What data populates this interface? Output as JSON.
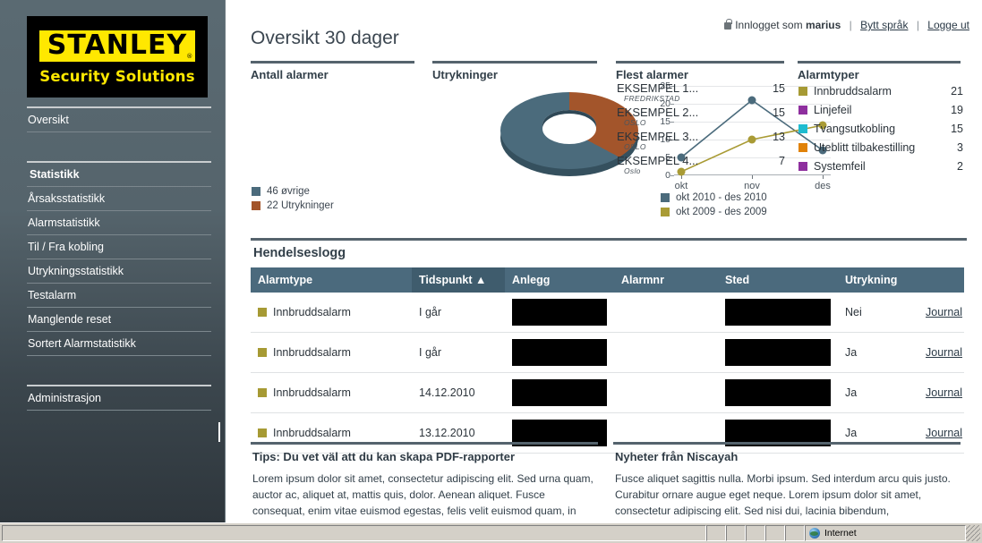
{
  "sidebar": {
    "logo": {
      "main": "STANLEY",
      "reg": "®",
      "sub": "Security Solutions"
    },
    "groups": [
      {
        "items": [
          {
            "label": "Oversikt",
            "bold": false
          }
        ]
      },
      {
        "items": [
          {
            "label": "Statistikk",
            "bold": true
          },
          {
            "label": "Årsaksstatistikk",
            "bold": false
          },
          {
            "label": "Alarmstatistikk",
            "bold": false
          },
          {
            "label": "Til / Fra kobling",
            "bold": false
          },
          {
            "label": "Utrykningsstatistikk",
            "bold": false
          },
          {
            "label": "Testalarm",
            "bold": false
          },
          {
            "label": "Manglende reset",
            "bold": false
          },
          {
            "label": "Sortert Alarmstatistikk",
            "bold": false
          }
        ]
      },
      {
        "items": [
          {
            "label": "Administrasjon",
            "bold": false
          }
        ]
      }
    ]
  },
  "topbar": {
    "logged_in_prefix": "Innlogget som",
    "user": "marius",
    "separator": "|",
    "change_language": "Bytt språk",
    "logout": "Logge ut"
  },
  "page": {
    "title": "Oversikt 30 dager"
  },
  "panels": {
    "alarm_count_title": "Antall alarmer",
    "utrykninger_title": "Utrykninger",
    "most_alarms_title": "Flest alarmer",
    "alarm_types_title": "Alarmtyper"
  },
  "chart_data": [
    {
      "type": "pie",
      "title": "Antall alarmer",
      "labels": [
        "46 øvrige",
        "22 Utrykninger"
      ],
      "values": [
        46,
        22
      ],
      "colors": [
        "#4b6b7c",
        "#a3552b"
      ],
      "legend_position": "bottom",
      "donut": true
    },
    {
      "type": "line",
      "title": "Utrykninger",
      "x": [
        "okt",
        "nov",
        "des"
      ],
      "series": [
        {
          "name": "okt 2010 - des 2010",
          "values": [
            5,
            21,
            7
          ],
          "color": "#4b6b7c"
        },
        {
          "name": "okt 2009 - des 2009",
          "values": [
            1,
            10,
            14
          ],
          "color": "#a99b35"
        }
      ],
      "ylim": [
        0,
        25
      ],
      "yticks": [
        0,
        5,
        10,
        15,
        20,
        25
      ],
      "xlabel": "",
      "ylabel": "",
      "grid": true,
      "legend_position": "bottom"
    },
    {
      "type": "table",
      "title": "Flest alarmer",
      "rows": [
        {
          "name": "EKSEMPEL 1...",
          "sub": "FREDRIKSTAD",
          "value": 15
        },
        {
          "name": "EKSEMPEL 2...",
          "sub": "OSLO",
          "value": 15
        },
        {
          "name": "EKSEMPEL 3...",
          "sub": "OSLO",
          "value": 13
        },
        {
          "name": "EKSEMPEL 4...",
          "sub": "Oslo",
          "value": 7
        }
      ]
    },
    {
      "type": "bar",
      "title": "Alarmtyper",
      "categories": [
        "Innbruddsalarm",
        "Linjefeil",
        "Tvangsutkobling",
        "Uteblitt tilbakestilling",
        "Systemfeil"
      ],
      "values": [
        21,
        19,
        15,
        3,
        2
      ],
      "colors": [
        "#a69a34",
        "#8e2f9e",
        "#1fbcd0",
        "#e08208",
        "#8e2f9e"
      ],
      "xlabel": "",
      "ylabel": ""
    }
  ],
  "log": {
    "section_title": "Hendelseslogg",
    "columns": [
      "Alarmtype",
      "Tidspunkt ▲",
      "Anlegg",
      "Alarmnr",
      "Sted",
      "Utrykning",
      ""
    ],
    "sorted_column_index": 1,
    "rows": [
      {
        "type": "Innbruddsalarm",
        "type_color": "#a69a34",
        "time": "I går",
        "anlegg": "",
        "anlegg_redacted": true,
        "alarmnr": "",
        "sted": "",
        "sted_redacted": true,
        "utrykning": "Nei",
        "link": "Journal"
      },
      {
        "type": "Innbruddsalarm",
        "type_color": "#a69a34",
        "time": "I går",
        "anlegg": "",
        "anlegg_redacted": true,
        "alarmnr": "",
        "sted": "",
        "sted_redacted": true,
        "utrykning": "Ja",
        "link": "Journal"
      },
      {
        "type": "Innbruddsalarm",
        "type_color": "#a69a34",
        "time": "14.12.2010",
        "anlegg": "",
        "anlegg_redacted": true,
        "alarmnr": "",
        "sted": "",
        "sted_redacted": true,
        "utrykning": "Ja",
        "link": "Journal"
      },
      {
        "type": "Innbruddsalarm",
        "type_color": "#a69a34",
        "time": "13.12.2010",
        "anlegg": "",
        "anlegg_redacted": true,
        "alarmnr": "",
        "sted": "",
        "sted_redacted": true,
        "utrykning": "Ja",
        "link": "Journal"
      }
    ]
  },
  "info_boxes": [
    {
      "title": "Tips: Du vet väl att du kan skapa PDF-rapporter",
      "body": "Lorem ipsum dolor sit amet, consectetur adipiscing elit. Sed urna quam, auctor ac, aliquet at, mattis quis, dolor. Aenean aliquet. Fusce consequat, enim vitae euismod egestas, felis velit euismod quam, in"
    },
    {
      "title": "Nyheter från Niscayah",
      "body": "Fusce aliquet sagittis nulla. Morbi ipsum. Sed interdum arcu quis justo. Curabitur ornare augue eget neque. Lorem ipsum dolor sit amet, consectetur adipiscing elit. Sed nisi dui, lacinia bibendum,"
    }
  ],
  "statusbar": {
    "zone": "Internet"
  }
}
